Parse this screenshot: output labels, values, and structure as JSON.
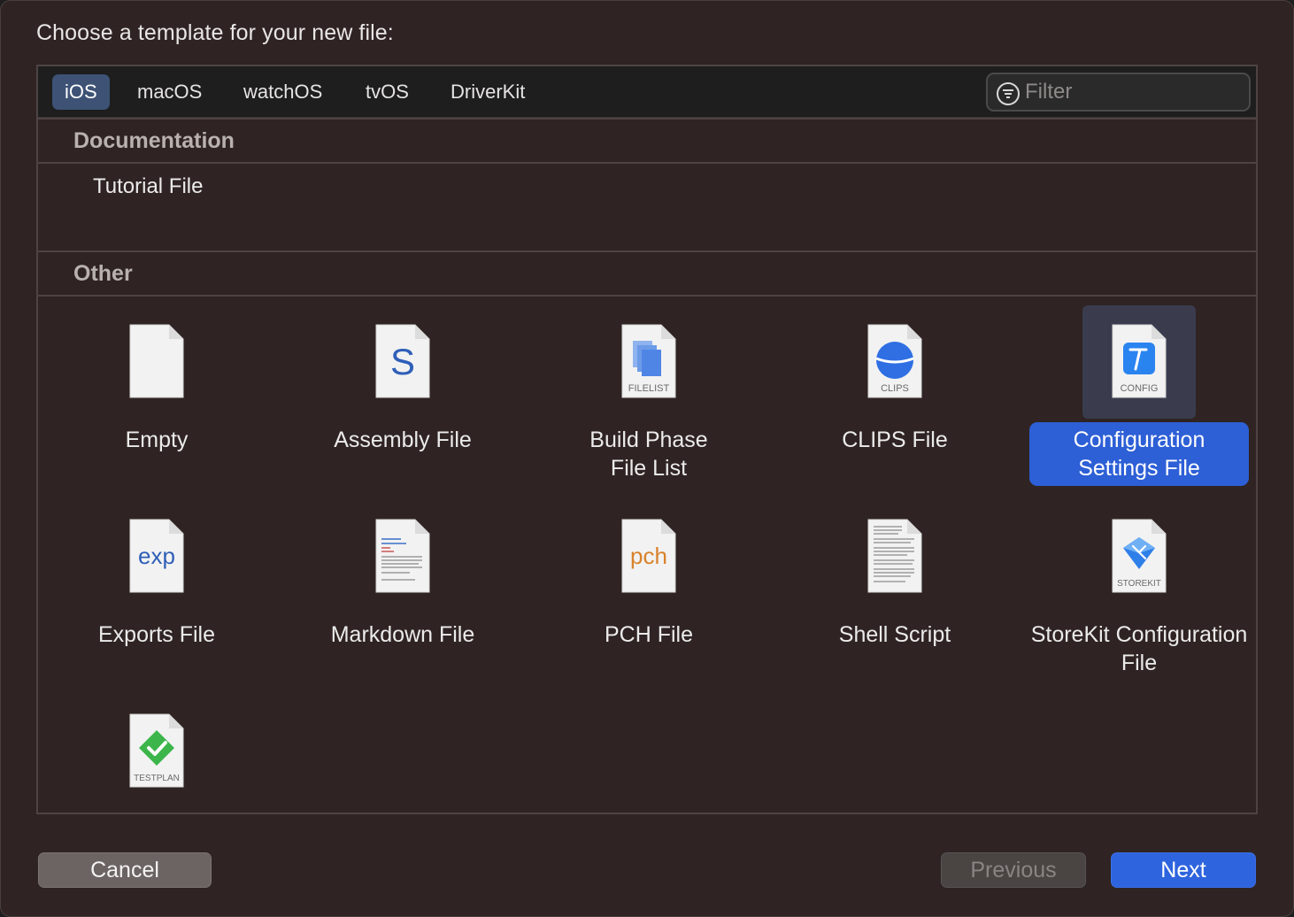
{
  "dialog": {
    "prompt": "Choose a template for your new file:"
  },
  "platforms": {
    "tabs": [
      "iOS",
      "macOS",
      "watchOS",
      "tvOS",
      "DriverKit"
    ],
    "selected": "iOS"
  },
  "filter": {
    "placeholder": "Filter",
    "value": ""
  },
  "sections": {
    "documentation": {
      "title": "Documentation",
      "items": [
        "Tutorial File"
      ]
    },
    "other": {
      "title": "Other",
      "items": [
        {
          "label": "Empty",
          "icon": "blank-document-icon",
          "badge": ""
        },
        {
          "label": "Assembly File",
          "icon": "assembly-s-icon",
          "badge": ""
        },
        {
          "label": "Build Phase File List",
          "icon": "filelist-icon",
          "badge": "FILELIST"
        },
        {
          "label": "CLIPS File",
          "icon": "clips-icon",
          "badge": "CLIPS"
        },
        {
          "label": "Configuration Settings File",
          "icon": "config-icon",
          "badge": "CONFIG",
          "selected": true
        },
        {
          "label": "Exports File",
          "icon": "exp-icon",
          "badge": "exp"
        },
        {
          "label": "Markdown File",
          "icon": "markdown-icon",
          "badge": ""
        },
        {
          "label": "PCH File",
          "icon": "pch-icon",
          "badge": "pch"
        },
        {
          "label": "Shell Script",
          "icon": "shell-script-icon",
          "badge": ""
        },
        {
          "label": "StoreKit Configuration File",
          "icon": "storekit-icon",
          "badge": "STOREKIT"
        },
        {
          "label": "",
          "icon": "testplan-icon",
          "badge": "TESTPLAN"
        }
      ]
    }
  },
  "buttons": {
    "cancel": "Cancel",
    "previous": "Previous",
    "next": "Next"
  },
  "colors": {
    "background": "#2f2423",
    "selection": "#2d5fd6",
    "active_tab": "#3d5275",
    "primary_button": "#2e64de"
  }
}
